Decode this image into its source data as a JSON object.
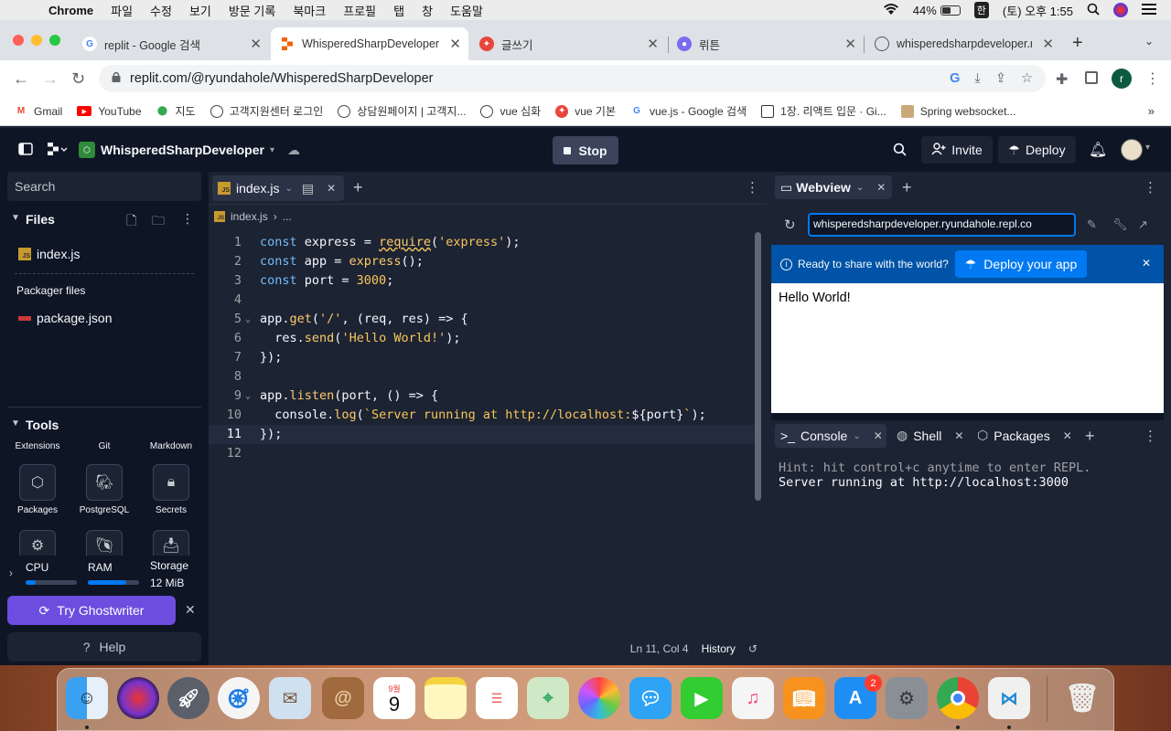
{
  "menubar": {
    "items": [
      "Chrome",
      "파일",
      "수정",
      "보기",
      "방문 기록",
      "북마크",
      "프로필",
      "탭",
      "창",
      "도움말"
    ],
    "battery": "44%",
    "input": "한",
    "clock": "(토) 오후 1:55"
  },
  "browser": {
    "tabs": [
      {
        "title": "replit - Google 검색",
        "icon": "google-icon"
      },
      {
        "title": "WhisperedSharpDeveloper",
        "icon": "replit-icon"
      },
      {
        "title": "글쓰기",
        "icon": "red-icon"
      },
      {
        "title": "뤼튼",
        "icon": "wrtn-icon"
      },
      {
        "title": "whisperedsharpdeveloper.r",
        "icon": "globe-icon"
      }
    ],
    "url": "replit.com/@ryundahole/WhisperedSharpDeveloper",
    "profile": "r",
    "bookmarks": [
      "Gmail",
      "YouTube",
      "지도",
      "고객지원센터 로그인",
      "상담원페이지 | 고객지...",
      "vue 심화",
      "vue 기본",
      "vue.js - Google 검색",
      "1장. 리액트 입문 · Gi...",
      "Spring websocket..."
    ]
  },
  "replit": {
    "repl_name": "WhisperedSharpDeveloper",
    "stop_label": "Stop",
    "invite_label": "Invite",
    "deploy_label": "Deploy",
    "sidebar": {
      "search_placeholder": "Search",
      "files_label": "Files",
      "files": [
        "index.js"
      ],
      "packager_label": "Packager files",
      "packager_files": [
        "package.json"
      ],
      "tools_label": "Tools",
      "tool_headers": [
        "Extensions",
        "Git",
        "Markdown"
      ],
      "tools": [
        "Packages",
        "PostgreSQL",
        "Secrets"
      ],
      "cpu_label": "CPU",
      "ram_label": "RAM",
      "storage_label": "Storage",
      "storage_value": "12 MiB",
      "cpu_usage": 0.2,
      "ram_usage": 0.75,
      "ghostwriter_label": "Try Ghostwriter",
      "help_label": "Help"
    },
    "editor": {
      "tab_label": "index.js",
      "breadcrumb_file": "index.js",
      "breadcrumb_more": "...",
      "cursor": "Ln 11, Col 4",
      "history_label": "History",
      "current_line": 11,
      "lines": [
        "const express = require('express');",
        "const app = express();",
        "const port = 3000;",
        "",
        "app.get('/', (req, res) => {",
        "  res.send('Hello World!');",
        "});",
        "",
        "app.listen(port, () => {",
        "  console.log(`Server running at http://localhost:${port}`);",
        "});",
        ""
      ]
    },
    "webview": {
      "tab_label": "Webview",
      "url": "whisperedsharpdeveloper.ryundahole.repl.co",
      "banner_text": "Ready to share with the world?",
      "deploy_app_label": "Deploy your app",
      "page_text": "Hello World!"
    },
    "console": {
      "tabs": [
        "Console",
        "Shell",
        "Packages"
      ],
      "hint": "Hint: hit control+c anytime to enter REPL.",
      "output": "Server running at http://localhost:3000"
    }
  },
  "dock": {
    "calendar_month": "9월",
    "calendar_day": "9",
    "appstore_badge": "2"
  }
}
